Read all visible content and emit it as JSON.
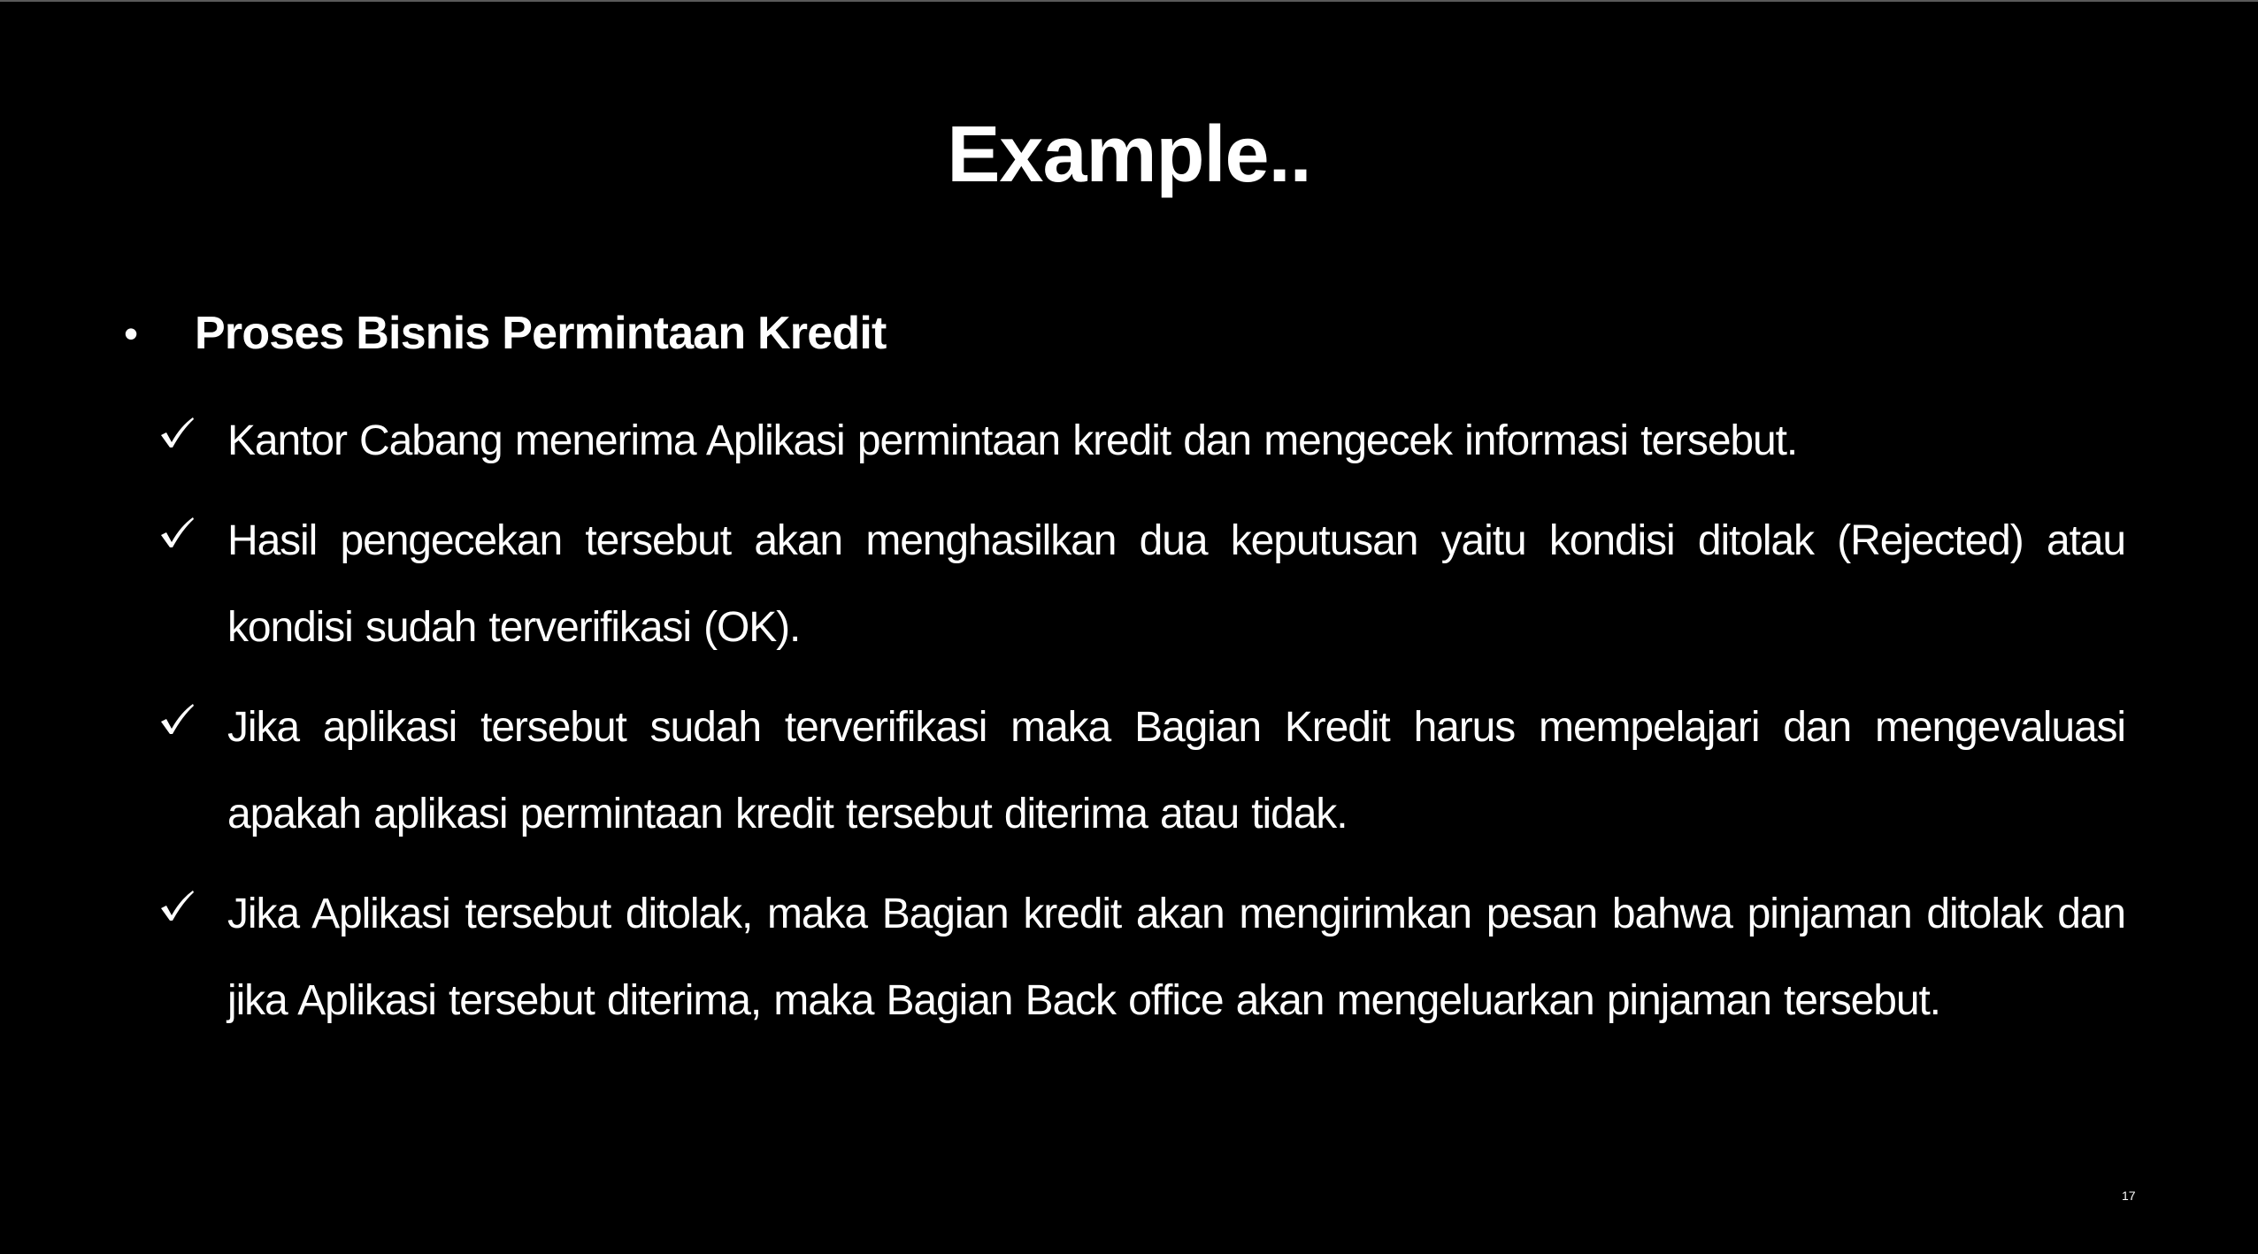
{
  "slide": {
    "title": "Example..",
    "page_number": "17",
    "colors": {
      "background": "#000000",
      "text": "#ffffff"
    }
  },
  "content": {
    "bullet_icon": "bullet-dot",
    "heading": "Proses Bisnis Permintaan Kredit",
    "check_icon": "checkmark",
    "items": [
      {
        "text": "Kantor Cabang menerima Aplikasi permintaan kredit dan mengecek informasi tersebut."
      },
      {
        "text": "Hasil pengecekan tersebut akan menghasilkan dua keputusan yaitu kondisi ditolak (Rejected) atau kondisi sudah terverifikasi (OK)."
      },
      {
        "text": "Jika aplikasi tersebut sudah terverifikasi maka Bagian Kredit harus mempelajari dan mengevaluasi apakah aplikasi permintaan kredit tersebut diterima atau tidak."
      },
      {
        "text": "Jika Aplikasi tersebut ditolak, maka Bagian kredit akan mengirimkan pesan bahwa pinjaman ditolak dan jika Aplikasi tersebut diterima, maka Bagian Back office akan mengeluarkan pinjaman tersebut."
      }
    ]
  }
}
